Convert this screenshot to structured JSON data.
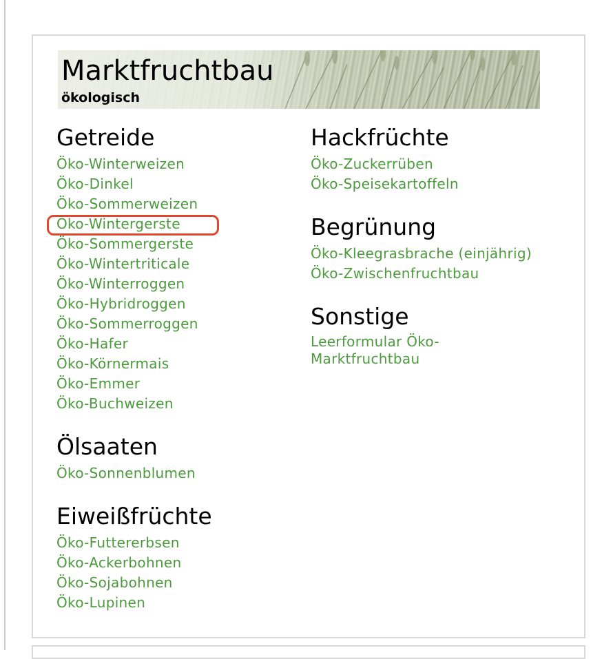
{
  "banner": {
    "title": "Marktfruchtbau",
    "subtitle": "ökologisch"
  },
  "sections": {
    "getreide": {
      "heading": "Getreide",
      "links": [
        "Öko-Winterweizen",
        "Öko-Dinkel",
        "Öko-Sommerweizen",
        "Öko-Wintergerste",
        "Öko-Sommergerste",
        "Öko-Wintertriticale",
        "Öko-Winterroggen",
        "Öko-Hybridroggen",
        "Öko-Sommerroggen",
        "Öko-Hafer",
        "Öko-Körnermais",
        "Öko-Emmer",
        "Öko-Buchweizen"
      ]
    },
    "oelsaaten": {
      "heading": "Ölsaaten",
      "links": [
        "Öko-Sonnenblumen"
      ]
    },
    "eiweiss": {
      "heading": "Eiweißfrüchte",
      "links": [
        "Öko-Futtererbsen",
        "Öko-Ackerbohnen",
        "Öko-Sojabohnen",
        "Öko-Lupinen"
      ]
    },
    "hackfruechte": {
      "heading": "Hackfrüchte",
      "links": [
        "Öko-Zuckerrüben",
        "Öko-Speisekartoffeln"
      ]
    },
    "begruenung": {
      "heading": "Begrünung",
      "links": [
        "Öko-Kleegrasbrache (einjährig)",
        "Öko-Zwischenfruchtbau"
      ]
    },
    "sonstige": {
      "heading": "Sonstige",
      "links": [
        "Leerformular Öko-Marktfruchtbau"
      ]
    }
  },
  "colors": {
    "link": "#4b9a3c",
    "highlight": "#e2462d"
  },
  "highlighted_item": "Öko-Wintergerste"
}
